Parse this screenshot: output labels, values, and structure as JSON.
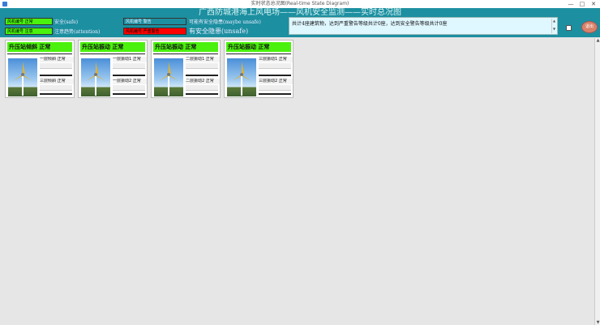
{
  "window": {
    "title": "实时状态总况图(Real-time State Diagram)",
    "minimize": "—",
    "maximize": "□",
    "close": "✕"
  },
  "header": {
    "title": "广西防城港海上风电场——风机安全监测——实时总况图",
    "legend": [
      {
        "box": "风机编号 正常",
        "text": "安全(safe)",
        "color": "#4af10d"
      },
      {
        "box": "风机编号 注意",
        "text": "注意趋势(attention)",
        "color": "#4af10d"
      },
      {
        "box": "风机编号 警告",
        "text": "可能有安全隐患(maybe unsafe)",
        "color": "#1c8fa0"
      },
      {
        "box": "风机编号 严重警告",
        "text": "有安全隐患(unsafe)",
        "color": "#ff0000"
      }
    ],
    "notice": "共计4座建筑物，达到严重警告等级共计0座，达到安全警告等级共计0座",
    "scroll_up": "▲",
    "scroll_down": "▼",
    "exit": "退出"
  },
  "panels": [
    {
      "title": "升压站倾斜 正常",
      "sensors": [
        "一层倾斜 正常",
        "三层倾斜 正常"
      ]
    },
    {
      "title": "升压站振动 正常",
      "sensors": [
        "一层振动1 正常",
        "一层振动2 正常"
      ]
    },
    {
      "title": "升压站振动 正常",
      "sensors": [
        "二层振动1 正常",
        "二层振动2 正常"
      ]
    },
    {
      "title": "升压站振动 正常",
      "sensors": [
        "三层振动1 正常",
        "三层振动2 正常"
      ]
    }
  ],
  "scrollbar": {
    "up": "▲",
    "down": "▼"
  }
}
